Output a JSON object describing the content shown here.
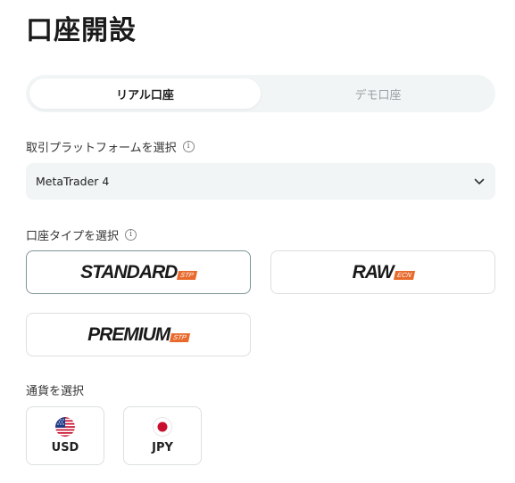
{
  "page": {
    "title": "口座開設"
  },
  "tabs": [
    {
      "label": "リアル口座",
      "active": true
    },
    {
      "label": "デモ口座",
      "active": false
    }
  ],
  "platform": {
    "label": "取引プラットフォームを選択",
    "selected": "MetaTrader 4"
  },
  "account_type": {
    "label": "口座タイプを選択",
    "options": [
      {
        "name": "STANDARD",
        "badge": "STP",
        "selected": true
      },
      {
        "name": "RAW",
        "badge": "ECN",
        "selected": false
      },
      {
        "name": "PREMIUM",
        "badge": "STP",
        "selected": false
      }
    ]
  },
  "currency": {
    "label": "通貨を選択",
    "options": [
      {
        "code": "USD",
        "flag": "us-flag-icon"
      },
      {
        "code": "JPY",
        "flag": "jp-flag-icon"
      }
    ]
  },
  "colors": {
    "accent_badge": "#e86a2c",
    "selected_border": "#7d9496",
    "field_bg": "#f1f5f6"
  }
}
